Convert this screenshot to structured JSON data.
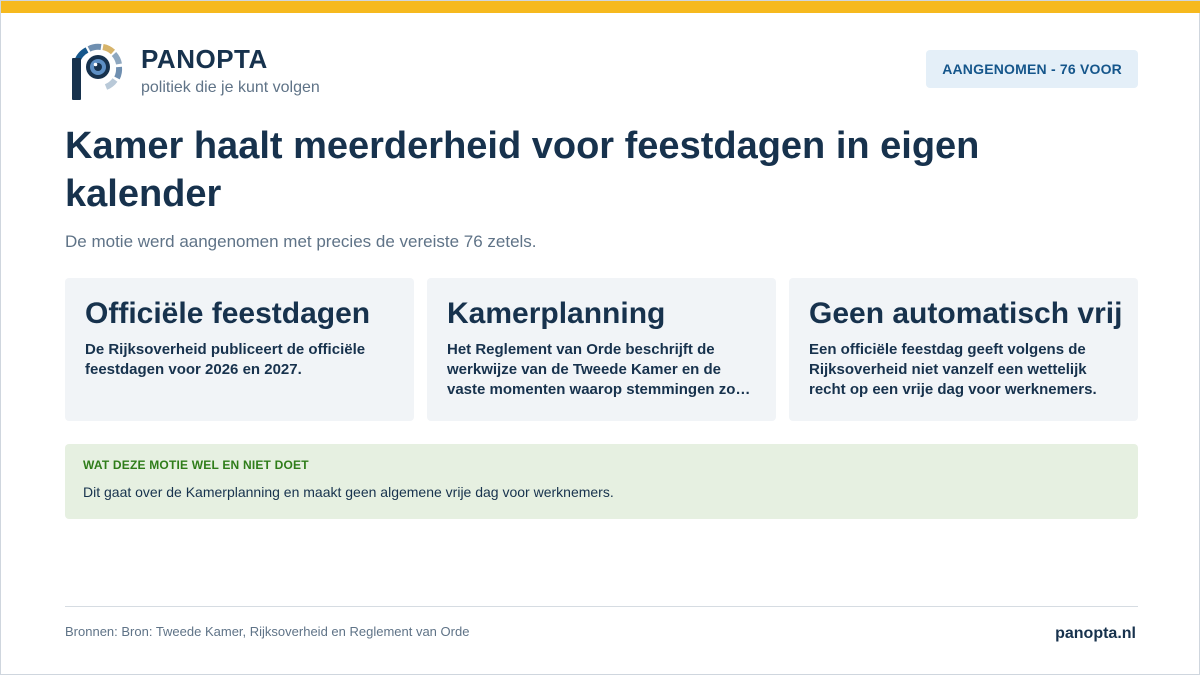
{
  "colors": {
    "accent_bar": "#f6b91e",
    "navy": "#17324d",
    "muted": "#5f7387",
    "badge_bg": "#e4eff8",
    "badge_text": "#15568b",
    "card_bg": "#f1f4f7",
    "note_bg": "#e6f0e1",
    "note_label": "#2f7d1a"
  },
  "brand": {
    "logo_icon": "panopta-eye-logo-icon",
    "name": "PANOPTA",
    "tagline": "politiek die je kunt volgen"
  },
  "badge": {
    "label": "AANGENOMEN - 76 VOOR"
  },
  "headline": {
    "title": "Kamer haalt meerderheid voor feestdagen in eigen kalender",
    "subtitle": "De motie werd aangenomen met precies de vereiste 76 zetels."
  },
  "cards": [
    {
      "title": "Officiële feestdagen",
      "text": "De Rijksoverheid publiceert de officiële feestdagen voor 2026 en 2027."
    },
    {
      "title": "Kamerplanning",
      "text": "Het Reglement van Orde beschrijft de werkwijze van de Tweede Kamer en de vaste momenten waarop stemmingen zo…"
    },
    {
      "title": "Geen automatisch vrij",
      "text": "Een officiële feestdag geeft volgens de Rijksoverheid niet vanzelf een wettelijk recht op een vrije dag voor werknemers."
    }
  ],
  "note": {
    "label": "WAT DEZE MOTIE WEL EN NIET DOET",
    "text": "Dit gaat over de Kamerplanning en maakt geen algemene vrije dag voor werknemers."
  },
  "footer": {
    "sources": "Bronnen: Bron: Tweede Kamer, Rijksoverheid en Reglement van Orde",
    "site": "panopta.nl"
  }
}
